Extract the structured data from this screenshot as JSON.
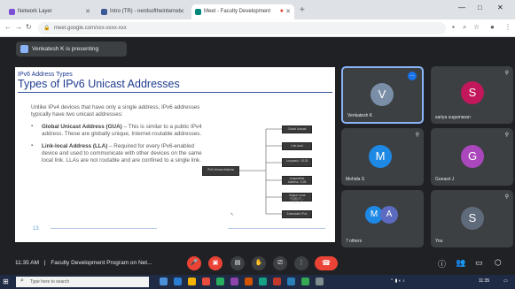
{
  "browser": {
    "tabs": [
      {
        "label": "Network Layer",
        "color": "#7b4fd6",
        "active": false
      },
      {
        "label": "Intro (TR) - nerdsoftheinternet",
        "color": "#3b5998",
        "active": false
      },
      {
        "label": "Meet - Faculty Development",
        "color": "#00897b",
        "active": true
      }
    ],
    "new_tab_symbol": "+",
    "url": "meet.google.com/xxx-xxxx-xxx",
    "window_controls": [
      "—",
      "□",
      "✕"
    ]
  },
  "meet": {
    "presenter_banner": "Venkatesh K is presenting",
    "slide": {
      "small_title": "IPv6 Address Types",
      "title": "Types of IPv6 Unicast Addresses",
      "intro": "Unlike IPv4 devices that have only a single address, IPv6 addresses typically have two unicast addresses:",
      "bullets": [
        {
          "term": "Global Unicast Address (GUA)",
          "text": " – This is similar to a public IPv4 address. These are globally unique, Internet-routable addresses."
        },
        {
          "term": "Link-local Address (LLA)",
          "text": " – Required for every IPv6-enabled device and used to communicate with other devices on the same local link. LLAs are not routable and are confined to a single link."
        }
      ],
      "footer_number": "13",
      "tree": {
        "root": "IPv6 Unicast Address",
        "children": [
          "Global Unicast",
          "Link-local",
          "Loopback ::1/128",
          "Unspecified Address ::/128",
          "Unique Local FC00::/7 – FDFF::/7",
          "Embedded IPv4"
        ]
      }
    },
    "participants": [
      {
        "name": "Venkatesh K",
        "initial": "V",
        "color": "#7b8ea8",
        "speaking": true
      },
      {
        "name": "sariya sugumaran",
        "initial": "S",
        "color": "#c2185b",
        "speaking": false
      },
      {
        "name": "Mohida S",
        "initial": "M",
        "color": "#1e88e5",
        "speaking": false
      },
      {
        "name": "Gunasri J",
        "initial": "G",
        "color": "#ab47bc",
        "speaking": false
      },
      {
        "name": "7 others",
        "initials": [
          "M",
          "A"
        ],
        "colors": [
          "#1e88e5",
          "#5c6bc0"
        ],
        "speaking": false
      },
      {
        "name": "You",
        "initial": "S",
        "color": "#5f6b7a",
        "speaking": false
      }
    ],
    "controls": {
      "time": "11:35 AM",
      "meeting_title": "Faculty Development Program on Net...",
      "separator": "|",
      "buttons": [
        "mic-off",
        "cam-off",
        "captions",
        "raise-hand",
        "present",
        "more"
      ],
      "end_call_symbol": "☎"
    }
  },
  "taskbar": {
    "search_placeholder": "Type here to search",
    "tray_time": "11:35"
  }
}
